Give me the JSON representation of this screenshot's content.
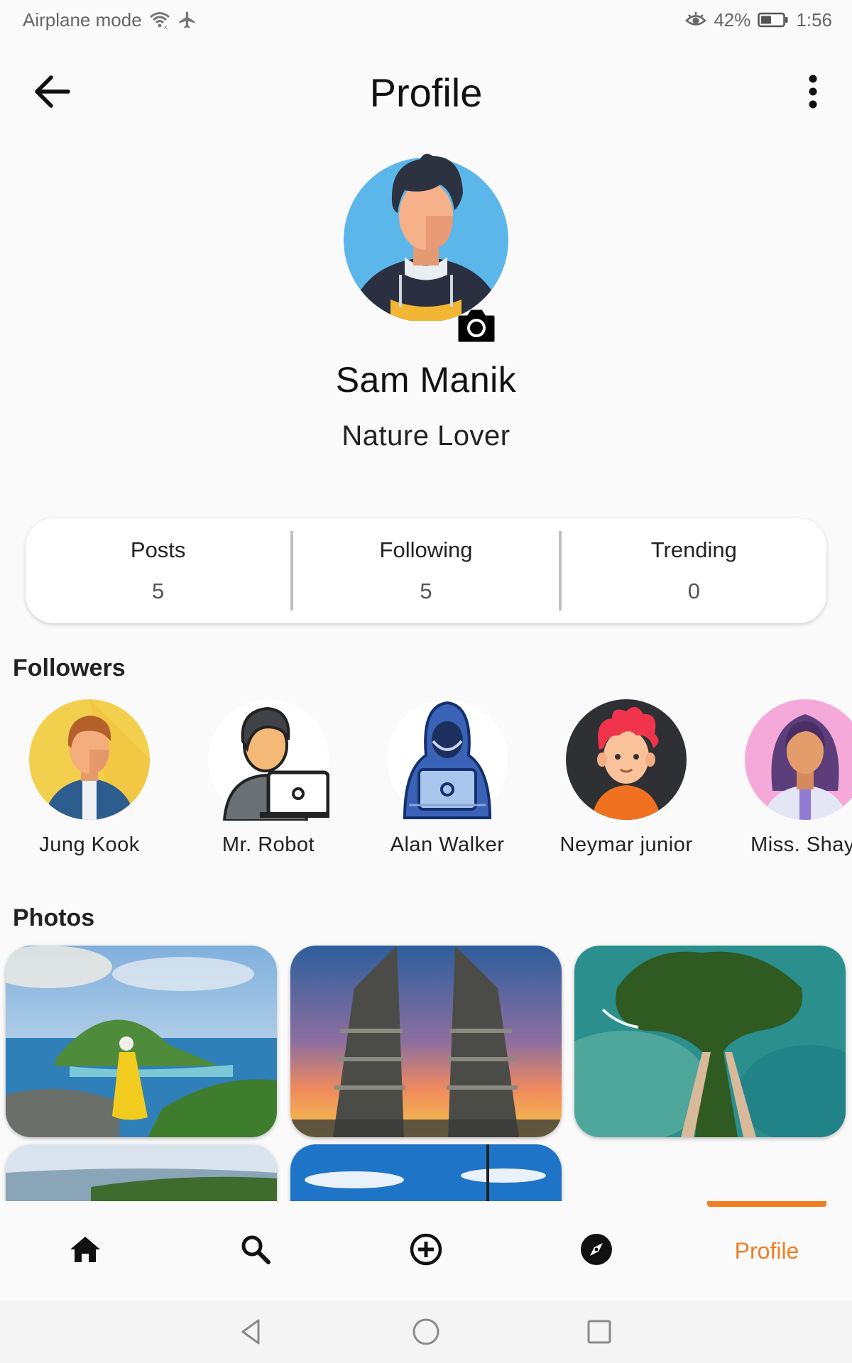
{
  "status_bar": {
    "left_text": "Airplane mode",
    "battery": "42%",
    "time": "1:56",
    "icons": [
      "wifi-icon",
      "airplane-icon",
      "eye-icon",
      "battery-icon"
    ]
  },
  "header": {
    "title": "Profile",
    "back_icon": "arrow-left-icon",
    "more_icon": "more-vertical-icon"
  },
  "profile": {
    "name": "Sam Manik",
    "bio": "Nature Lover",
    "camera_icon": "camera-icon"
  },
  "stats": [
    {
      "label": "Posts",
      "value": "5"
    },
    {
      "label": "Following",
      "value": "5"
    },
    {
      "label": "Trending",
      "value": "0"
    }
  ],
  "followers": {
    "title": "Followers",
    "items": [
      {
        "name": "Jung Kook"
      },
      {
        "name": "Mr. Robot"
      },
      {
        "name": "Alan Walker"
      },
      {
        "name": "Neymar junior"
      },
      {
        "name": "Miss. Shayl"
      }
    ]
  },
  "photos": {
    "title": "Photos"
  },
  "bottom_nav": {
    "items": [
      {
        "icon": "home-icon"
      },
      {
        "icon": "search-icon"
      },
      {
        "icon": "add-circle-icon"
      },
      {
        "icon": "compass-icon"
      },
      {
        "label": "Profile"
      }
    ],
    "active_color": "#f07d22"
  },
  "system_nav": {
    "icons": [
      "back-triangle-icon",
      "home-circle-icon",
      "recents-square-icon"
    ]
  }
}
